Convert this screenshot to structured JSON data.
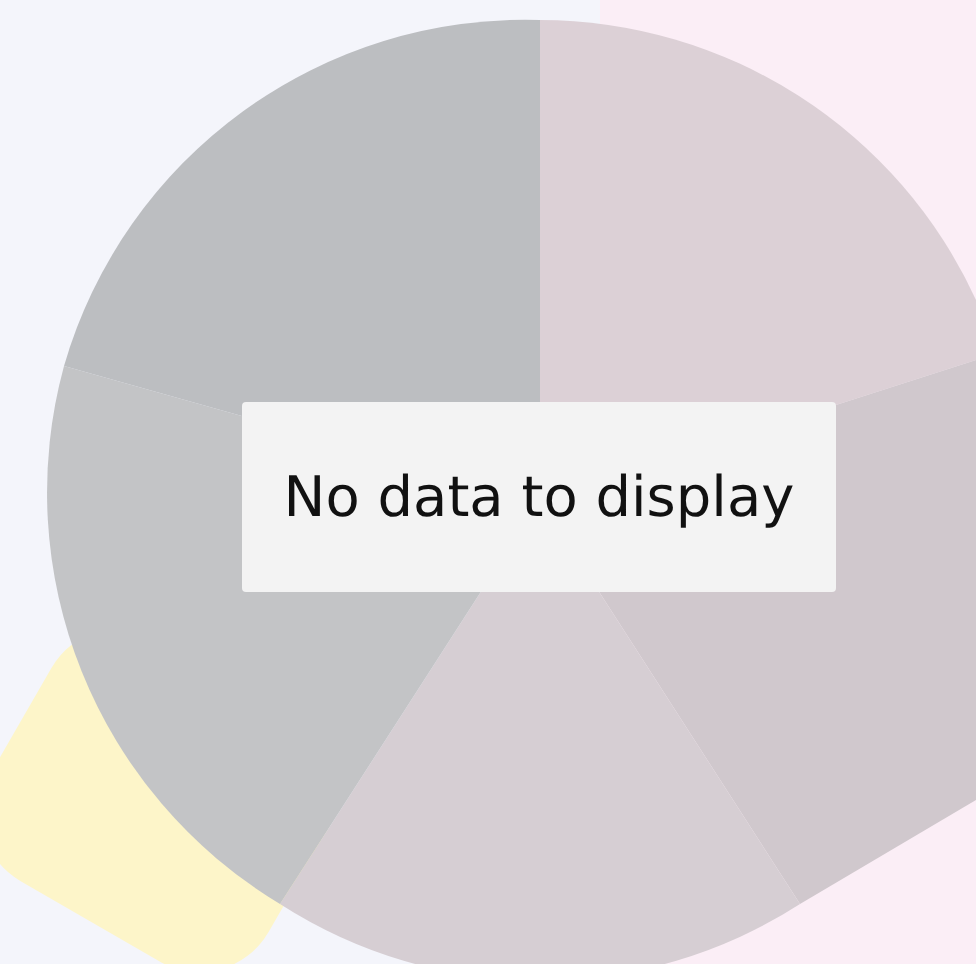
{
  "message": "No data to display"
}
